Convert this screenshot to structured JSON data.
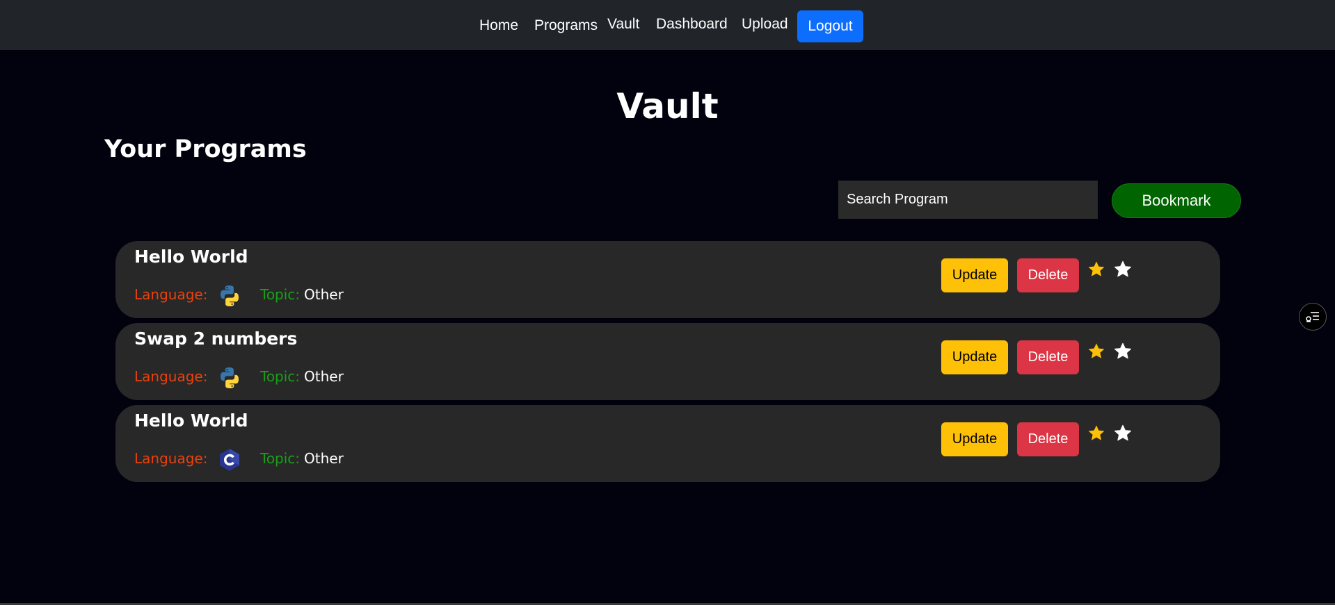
{
  "nav": {
    "items": [
      {
        "label": "Home"
      },
      {
        "label": "Programs"
      },
      {
        "label": "Vault"
      },
      {
        "label": "Dashboard"
      },
      {
        "label": "Upload"
      }
    ],
    "logout_label": "Logout",
    "logout_color": "#0d6efd"
  },
  "page": {
    "title": "Vault",
    "section_title": "Your Programs"
  },
  "search": {
    "placeholder": "Search Program",
    "value": ""
  },
  "bookmark": {
    "label": "Bookmark",
    "color": "#006400"
  },
  "programs": [
    {
      "name": "Hello World",
      "language_label": "Language:",
      "language_icon": "python-icon",
      "topic_label": "Topic:",
      "topic_value": "Other",
      "update_label": "Update",
      "delete_label": "Delete",
      "stars": [
        "filled-star",
        "outline-star"
      ]
    },
    {
      "name": "Swap 2 numbers",
      "language_label": "Language:",
      "language_icon": "python-icon",
      "topic_label": "Topic:",
      "topic_value": "Other",
      "update_label": "Update",
      "delete_label": "Delete",
      "stars": [
        "filled-star",
        "outline-star"
      ]
    },
    {
      "name": "Hello World",
      "language_label": "Language:",
      "language_icon": "c-language-icon",
      "topic_label": "Topic:",
      "topic_value": "Other",
      "update_label": "Update",
      "delete_label": "Delete",
      "stars": [
        "filled-star",
        "outline-star"
      ]
    }
  ],
  "colors": {
    "background": "#02020f",
    "navbar": "#212529",
    "card": "#282828",
    "language_label": "#e8420c",
    "topic_label": "#18a018",
    "update": "#ffc107",
    "delete": "#dc3545",
    "star": "#ffc107"
  },
  "side_widget_icon": "accessibility-menu-icon"
}
